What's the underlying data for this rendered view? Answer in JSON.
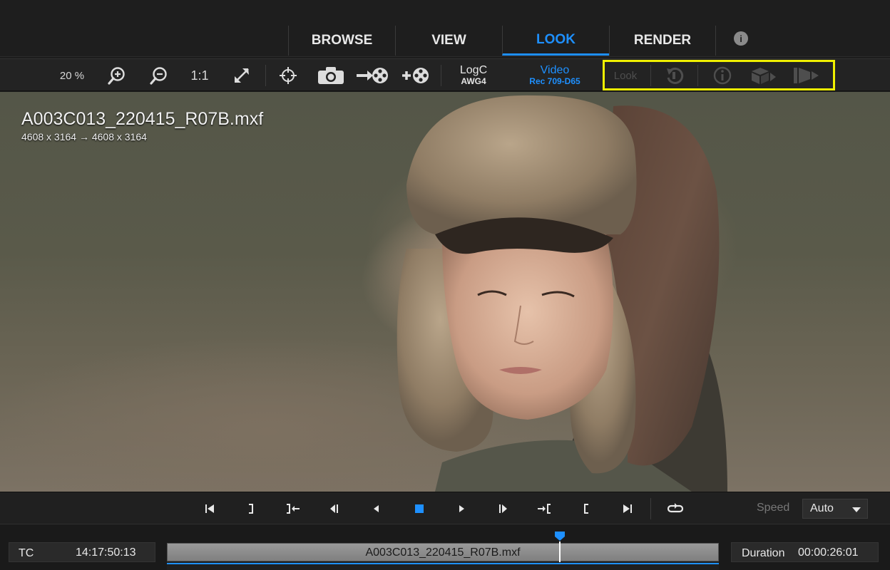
{
  "nav": {
    "tabs": [
      {
        "label": "BROWSE"
      },
      {
        "label": "VIEW"
      },
      {
        "label": "LOOK",
        "active": true
      },
      {
        "label": "RENDER"
      }
    ],
    "info_icon": "i"
  },
  "toolbar": {
    "zoom_level": "20 %",
    "one_to_one": "1:1",
    "input_colorspace": {
      "line1": "LogC",
      "line2": "AWG4"
    },
    "output_colorspace": {
      "line1": "Video",
      "line2": "Rec 709-D65"
    },
    "look_label": "Look",
    "icons": [
      "zoom-in-icon",
      "zoom-out-icon",
      "fit-icon",
      "crosshair-icon",
      "camera-icon",
      "export-reel-icon",
      "add-reel-icon",
      "reset-icon",
      "info-icon",
      "export-box-icon",
      "export-look-icon"
    ],
    "highlight_color": "#f0f000"
  },
  "viewer": {
    "clip_name": "A003C013_220415_R07B.mxf",
    "resolution": "4608 x 3164  → 4608 x 3164"
  },
  "transport": {
    "speed_label": "Speed",
    "speed_value": "Auto",
    "accent_color": "#1e90ff"
  },
  "timeline": {
    "tc_label": "TC",
    "tc_value": "14:17:50:13",
    "clip_name": "A003C013_220415_R07B.mxf",
    "duration_label": "Duration",
    "duration_value": "00:00:26:01"
  }
}
